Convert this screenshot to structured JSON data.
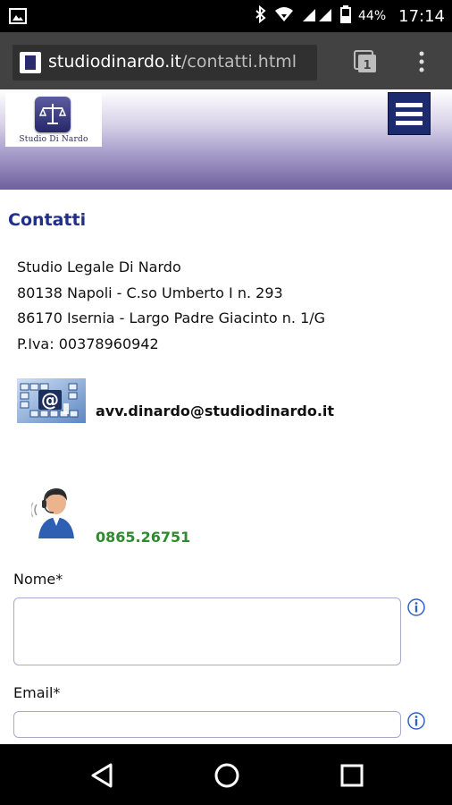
{
  "status_bar": {
    "battery_percent": "44%",
    "time": "17:14",
    "icons": [
      "image-icon",
      "bluetooth-icon",
      "wifi-icon",
      "signal-icon",
      "battery-icon"
    ]
  },
  "browser": {
    "url_host": "studiodinardo.it",
    "url_path": "/contatti.html",
    "tab_count": "1"
  },
  "header": {
    "logo_text": "Studio Di Nardo"
  },
  "main": {
    "title": "Contatti",
    "address_lines": [
      "Studio Legale Di Nardo",
      "80138 Napoli - C.so Umberto I n. 293",
      "86170 Isernia - Largo Padre Giacinto n. 1/G",
      "P.Iva: 00378960942"
    ],
    "email": "avv.dinardo@studiodinardo.it",
    "phone": "0865.26751"
  },
  "form": {
    "name_label": "Nome*",
    "name_value": "",
    "email_label": "Email*",
    "email_value": ""
  },
  "colors": {
    "title_blue": "#1f2f8a",
    "phone_green": "#2e8b2e",
    "hamburger_bg": "#1e2a6e"
  }
}
